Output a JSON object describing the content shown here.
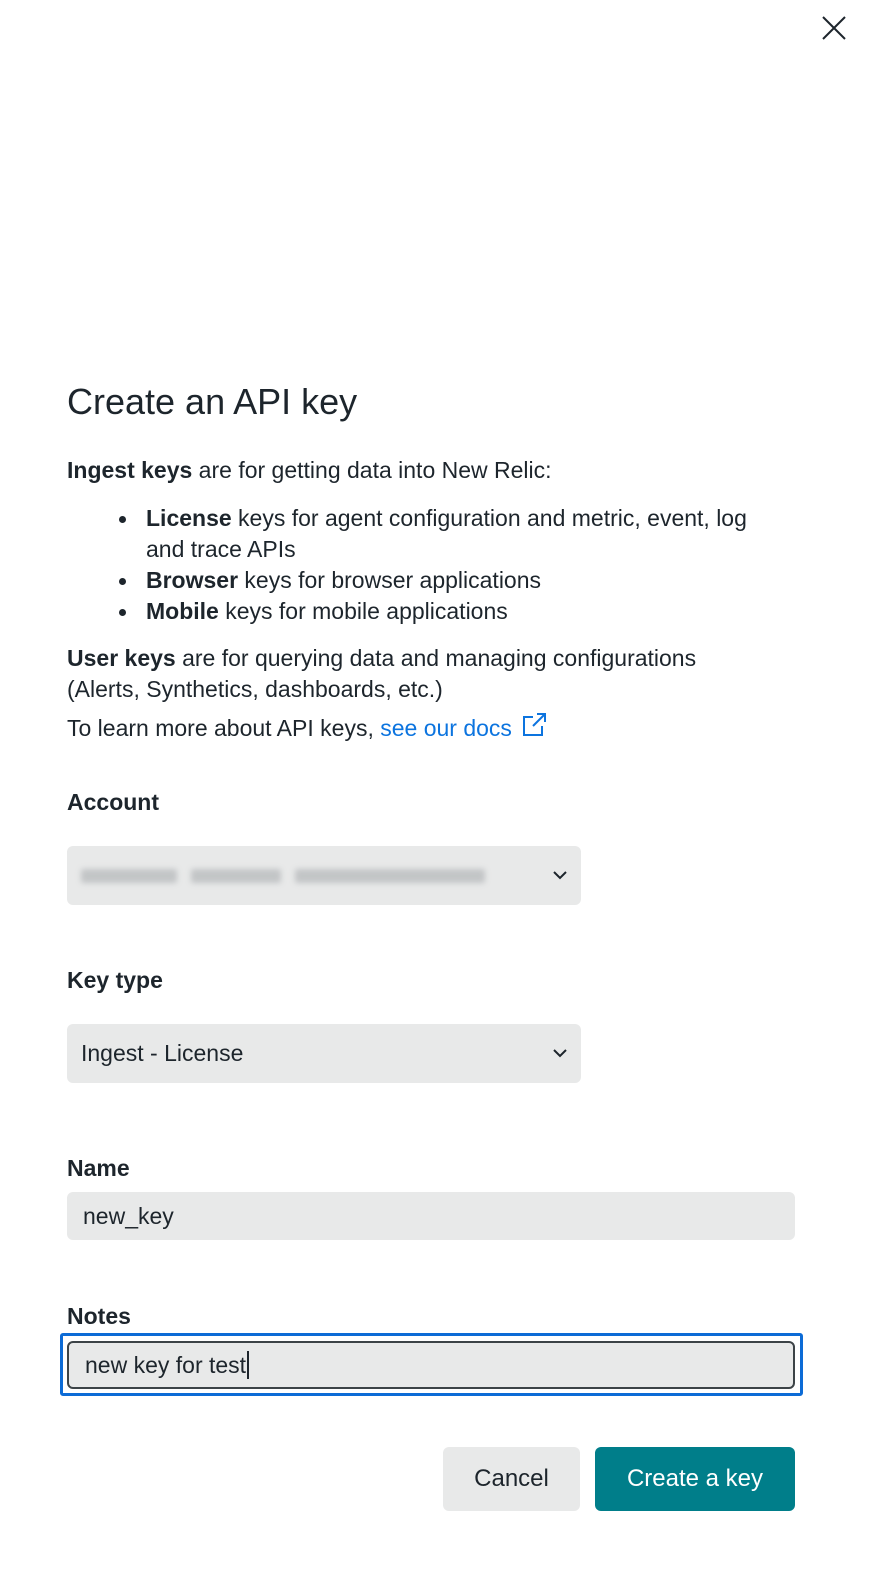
{
  "dialog": {
    "title": "Create an API key",
    "close_icon": "close-icon"
  },
  "description": {
    "ingest_bold": "Ingest keys",
    "ingest_rest": " are for getting data into New Relic:",
    "bullets": [
      {
        "bold": "License",
        "rest": " keys for agent configuration and metric, event, log and trace APIs"
      },
      {
        "bold": "Browser",
        "rest": " keys for browser applications"
      },
      {
        "bold": "Mobile",
        "rest": " keys for mobile applications"
      }
    ],
    "user_bold": "User keys",
    "user_rest": " are for querying data and managing configurations (Alerts, Synthetics, dashboards, etc.)",
    "learn_prefix": "To learn more about API keys, ",
    "docs_link": "see our docs",
    "external_icon": "external-link-icon"
  },
  "form": {
    "account": {
      "label": "Account",
      "value_redacted": true
    },
    "key_type": {
      "label": "Key type",
      "value": "Ingest - License"
    },
    "name": {
      "label": "Name",
      "value": "new_key"
    },
    "notes": {
      "label": "Notes",
      "value": "new key for test"
    }
  },
  "actions": {
    "cancel": "Cancel",
    "create": "Create a key"
  },
  "colors": {
    "primary": "#007e8a",
    "link": "#0c74df",
    "focus": "#0c6bd6",
    "field_bg": "#e8e9e9"
  }
}
